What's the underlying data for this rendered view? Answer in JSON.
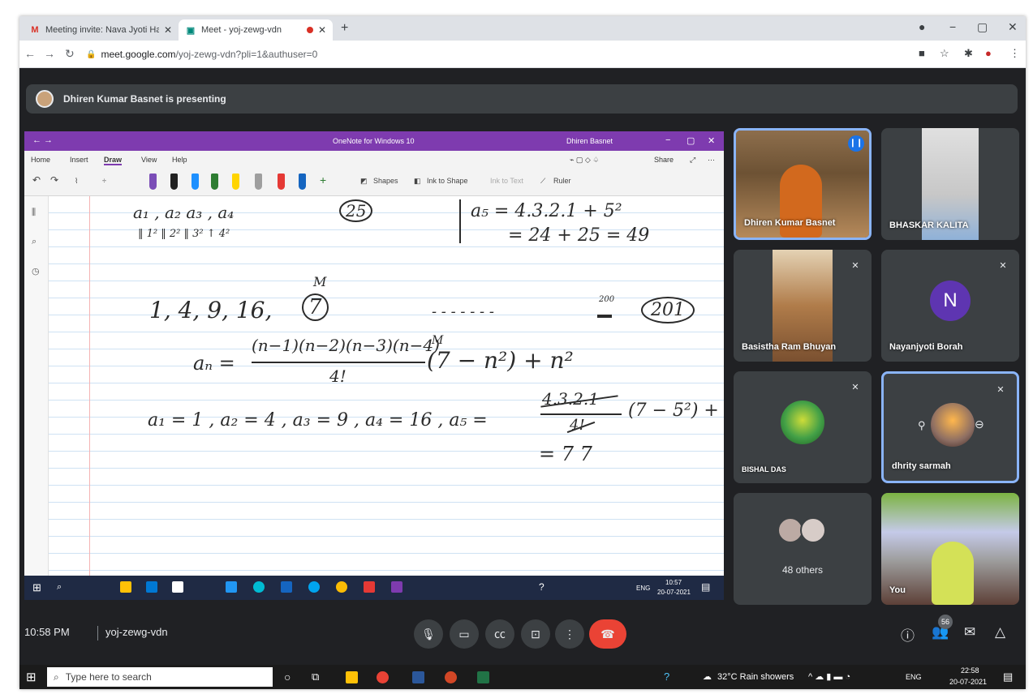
{
  "browser": {
    "tabs": [
      {
        "label": "Meeting invite: Nava Jyoti Hazari",
        "icon": "gmail-icon"
      },
      {
        "label": "Meet - yoj-zewg-vdn",
        "icon": "meet-icon"
      }
    ],
    "url_host": "meet.google.com",
    "url_path": "/yoj-zewg-vdn?pli=1&authuser=0"
  },
  "meeting": {
    "presenting_text": "Dhiren Kumar Basnet is presenting",
    "time": "10:58 PM",
    "code": "yoj-zewg-vdn",
    "participant_count": "56"
  },
  "onenote": {
    "title": "OneNote for Windows 10",
    "user": "Dhiren Basnet",
    "menu": [
      "Home",
      "Insert",
      "Draw",
      "View",
      "Help"
    ],
    "share_label": "Share",
    "tools": {
      "shapes": "Shapes",
      "ink_to_shape": "Ink to Shape",
      "ink_to_text": "Ink to Text",
      "ruler": "Ruler"
    },
    "pen_colors": [
      "#7b4db7",
      "#222222",
      "#1e90ff",
      "#2e7d32",
      "#ffd400",
      "#9e9e9e",
      "#e53935",
      "#1565c0"
    ]
  },
  "handwriting": {
    "line1": "a₁ ,  a₂   a₃ ,   a₄",
    "line1_circle": "25",
    "line1_sub": "‖ 1²     ‖ 2²     ‖ 3²     ↑ 4²",
    "a5_line1": "a₅ =  4.3.2.1 + 5²",
    "a5_line2": "=  24 + 25  = 49",
    "m_label": "M",
    "seq": "1, 4, 9, 16,",
    "seq_circle": "7",
    "dashes": "- - - - - - -",
    "n200": "200",
    "n201": "201",
    "formula_lhs": "aₙ =",
    "formula_num": "(n−1)(n−2)(n−3)(n−4)",
    "formula_den": "4!",
    "formula_m": "M",
    "formula_rhs": "(7 − n²) + n²",
    "values_line": "a₁ = 1 ,  a₂ =  4 ,    a₃ = 9 ,   a₄ = 16 ,   a₅ =",
    "frac_num": "4.3.2.1",
    "frac_den": "4!",
    "values_rhs": "(7 − 5²) + 5²",
    "result": "= 7 7"
  },
  "presenter_taskbar": {
    "lang": "ENG",
    "time": "10:57",
    "date": "20-07-2021"
  },
  "participants": [
    {
      "name": "Dhiren Kumar Basnet",
      "speaking": true
    },
    {
      "name": "BHASKAR KALITA",
      "muted": false
    },
    {
      "name": "Basistha Ram Bhuyan",
      "muted": true
    },
    {
      "name": "Nayanjyoti Borah",
      "muted": true,
      "initial": "N"
    },
    {
      "name": "BISHAL DAS",
      "muted": true
    },
    {
      "name": "dhrity sarmah",
      "muted": true
    },
    {
      "name": "48 others"
    },
    {
      "name": "You"
    }
  ],
  "host_taskbar": {
    "search_placeholder": "Type here to search",
    "weather": "32°C Rain showers",
    "lang": "ENG",
    "time": "22:58",
    "date": "20-07-2021"
  }
}
